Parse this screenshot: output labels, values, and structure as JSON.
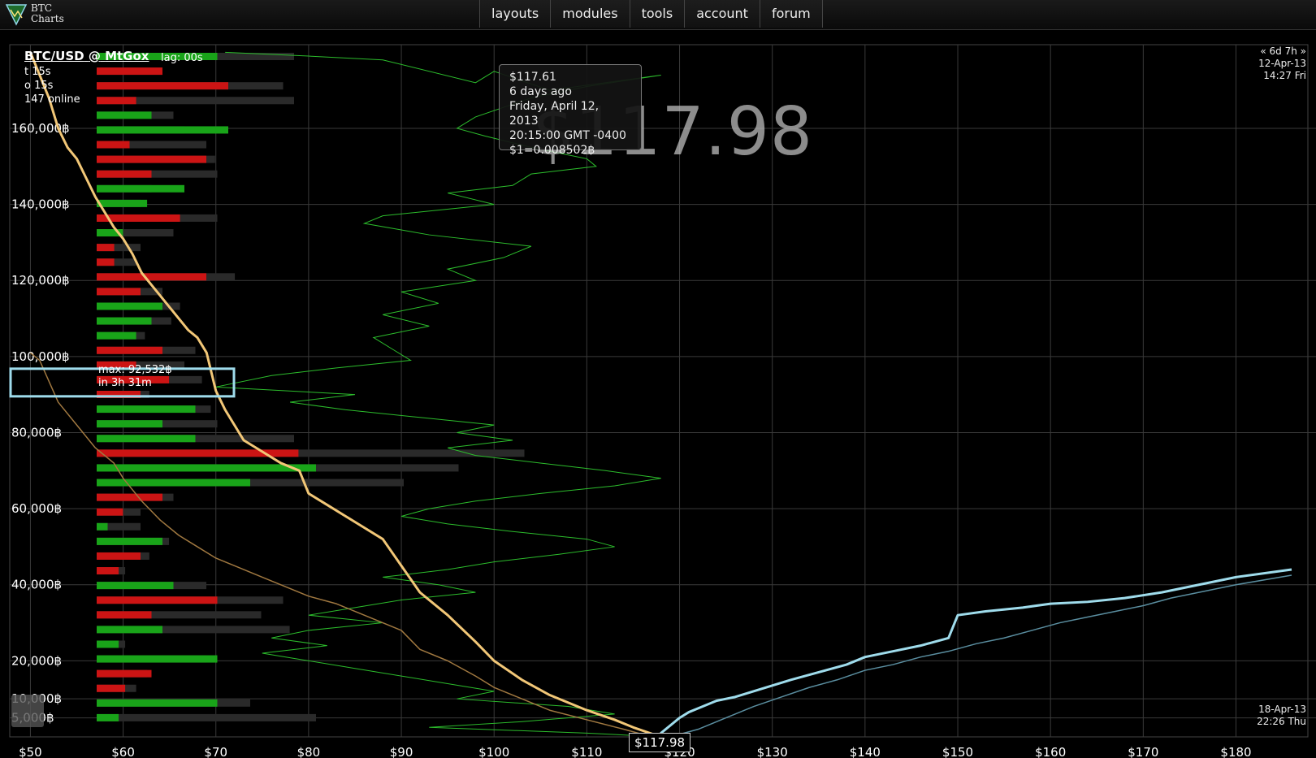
{
  "app": {
    "logo_line1": "BTC",
    "logo_line2": "Charts"
  },
  "nav": [
    "layouts",
    "modules",
    "tools",
    "account",
    "forum"
  ],
  "header": {
    "pair": "BTC/USD",
    "at": "@",
    "exchange": "MtGox",
    "lag": "lag: 00s",
    "lines": [
      "t 15s",
      "o 15s",
      "147 online"
    ]
  },
  "time_top": {
    "nav": "« 6d 7h »",
    "date": "12-Apr-13",
    "time": "14:27 Fri"
  },
  "time_bottom": {
    "date": "18-Apr-13",
    "time": "22:26 Thu"
  },
  "big_price": "$117.98",
  "current_price_label": "$117.98",
  "tooltip": {
    "price": "$117.61",
    "ago": "6 days  ago",
    "date": "Friday, April 12, 2013",
    "time": "20:15:00 GMT -0400",
    "rate": "$1=0.008502฿"
  },
  "max_note": {
    "line1": "max: 92,532฿",
    "line2": "in 3h 31m"
  },
  "colors": {
    "bid_depth": "#f2c777",
    "bid_depth_older": "#a07840",
    "ask_depth": "#9fdcec",
    "ask_depth_older": "#5a8ea0",
    "price": "#2cbc2c",
    "vol_up": "#19a419",
    "vol_down": "#cc1414",
    "grid": "#3a3a3a",
    "highlight": "#9fdcec"
  },
  "chart_data": {
    "type": "line",
    "xlabel": "",
    "ylabel": "",
    "x_ticks": [
      "$50",
      "$60",
      "$70",
      "$80",
      "$90",
      "$100",
      "$110",
      "$120",
      "$130",
      "$140",
      "$150",
      "$160",
      "$170",
      "$180"
    ],
    "xlim": [
      49,
      186
    ],
    "y_ticks": [
      "5,000฿",
      "10,000฿",
      "20,000฿",
      "40,000฿",
      "60,000฿",
      "80,000฿",
      "100,000฿",
      "120,000฿",
      "140,000฿",
      "160,000฿"
    ],
    "y_tick_values": [
      5000,
      10000,
      20000,
      40000,
      60000,
      80000,
      100000,
      120000,
      140000,
      160000
    ],
    "ylim": [
      0,
      182000
    ],
    "series": [
      {
        "kind": "bid_depth",
        "x": [
          50,
          51,
          52,
          53,
          54,
          55,
          56,
          57,
          58,
          59,
          60,
          61,
          62,
          63,
          64,
          65,
          66,
          67,
          68,
          69,
          70,
          71,
          72,
          73,
          75,
          77,
          79,
          80,
          82,
          84,
          86,
          88,
          90,
          92,
          95,
          98,
          100,
          103,
          106,
          110,
          113,
          115,
          117.98
        ],
        "y": [
          180000,
          174000,
          168000,
          160000,
          155000,
          152000,
          147000,
          142000,
          138000,
          134000,
          131000,
          127000,
          122000,
          119000,
          116000,
          113000,
          110000,
          107000,
          105000,
          101000,
          91000,
          86000,
          82000,
          78000,
          75000,
          72000,
          70000,
          64000,
          61000,
          58000,
          55000,
          52000,
          45000,
          38000,
          32000,
          25000,
          20000,
          15000,
          11000,
          7000,
          4500,
          2500,
          0
        ]
      },
      {
        "kind": "bid_depth_older",
        "x": [
          50,
          51,
          53,
          55,
          57,
          59,
          60,
          62,
          64,
          66,
          68,
          70,
          72,
          75,
          78,
          80,
          83,
          86,
          90,
          92,
          95,
          98,
          100,
          103,
          106,
          110,
          114,
          117
        ],
        "y": [
          101000,
          99000,
          88000,
          82000,
          76000,
          72000,
          68000,
          62000,
          57000,
          53000,
          50000,
          47000,
          45000,
          42000,
          39000,
          37000,
          35000,
          32000,
          28000,
          23000,
          20000,
          16000,
          13000,
          10000,
          7000,
          4500,
          2000,
          0
        ]
      },
      {
        "kind": "ask_depth",
        "x": [
          117.98,
          118,
          120,
          121,
          122,
          124,
          126,
          128,
          130,
          132,
          135,
          138,
          140,
          143,
          146,
          149,
          150,
          153,
          157,
          160,
          164,
          168,
          172,
          176,
          180,
          186
        ],
        "y": [
          0,
          1000,
          5000,
          6500,
          7500,
          9500,
          10500,
          12000,
          13500,
          15000,
          17000,
          19000,
          21000,
          22500,
          24000,
          26000,
          32000,
          33000,
          34000,
          35000,
          35500,
          36500,
          38000,
          40000,
          42000,
          44000
        ]
      },
      {
        "kind": "ask_depth_older",
        "x": [
          119,
          122,
          125,
          128,
          131,
          134,
          137,
          140,
          143,
          146,
          149,
          152,
          155,
          158,
          161,
          164,
          167,
          170,
          173,
          176,
          180,
          186
        ],
        "y": [
          0,
          2000,
          5000,
          8000,
          10500,
          13000,
          15000,
          17500,
          19000,
          21000,
          22500,
          24500,
          26000,
          28000,
          30000,
          31500,
          33000,
          34500,
          36500,
          38000,
          40000,
          42500
        ]
      }
    ],
    "price_trace": {
      "kind": "price",
      "x": [
        71,
        80,
        88,
        98,
        100,
        106,
        118,
        110,
        104,
        98,
        96,
        99,
        104,
        110,
        111,
        104,
        102,
        95,
        100,
        88,
        86,
        93,
        104,
        101,
        95,
        98,
        90,
        94,
        88,
        93,
        87,
        89,
        91,
        83,
        76,
        70,
        85,
        78,
        84,
        92,
        100,
        96,
        102,
        95,
        98,
        105,
        112,
        118,
        113,
        105,
        98,
        93,
        90,
        95,
        102,
        110,
        113,
        107,
        100,
        95,
        88,
        94,
        98,
        90,
        85,
        80,
        88,
        80,
        76,
        82,
        75,
        80,
        85,
        90,
        95,
        100,
        96,
        108,
        113,
        103,
        93,
        110,
        118
      ],
      "y": [
        180000,
        179000,
        178000,
        172000,
        175000,
        170000,
        174000,
        171000,
        168000,
        163000,
        160000,
        158000,
        155000,
        152000,
        150000,
        148000,
        145000,
        143000,
        140000,
        137000,
        135000,
        132000,
        129000,
        126000,
        123000,
        120000,
        117000,
        114000,
        111000,
        108000,
        105000,
        102000,
        99000,
        97000,
        95000,
        92000,
        90000,
        88000,
        86000,
        84000,
        82000,
        80000,
        78000,
        76000,
        74000,
        72000,
        70000,
        68000,
        66000,
        64000,
        62000,
        60000,
        58000,
        56000,
        54000,
        52000,
        50000,
        48000,
        46000,
        44000,
        42000,
        40000,
        38000,
        36000,
        34000,
        32000,
        30000,
        28000,
        26000,
        24000,
        22000,
        20000,
        18000,
        16000,
        14000,
        12000,
        10000,
        8000,
        6000,
        4000,
        2500,
        1000,
        0
      ]
    },
    "volume_bars": {
      "note_unit": "relative",
      "up": [
        1,
        0,
        0,
        0,
        1,
        1,
        0,
        0,
        0,
        1,
        1,
        0,
        1,
        0,
        0,
        0,
        0,
        1,
        1,
        1,
        0,
        0,
        0,
        0,
        1,
        1,
        1,
        0,
        1,
        1,
        0,
        0,
        1,
        1,
        0,
        0,
        1,
        0,
        0,
        1,
        1,
        1,
        0,
        0,
        1,
        1
      ],
      "bar": [
        0.55,
        0.3,
        0.6,
        0.18,
        0.25,
        0.6,
        0.15,
        0.5,
        0.25,
        0.4,
        0.23,
        0.38,
        0.12,
        0.08,
        0.08,
        0.5,
        0.2,
        0.3,
        0.25,
        0.18,
        0.3,
        0.18,
        0.33,
        0.2,
        0.45,
        0.3,
        0.45,
        0.92,
        1.0,
        0.7,
        0.3,
        0.12,
        0.05,
        0.3,
        0.2,
        0.1,
        0.35,
        0.55,
        0.25,
        0.3,
        0.1,
        0.55,
        0.25,
        0.13,
        0.55,
        0.1
      ],
      "shadow": [
        0.9,
        0.3,
        0.85,
        0.9,
        0.35,
        0.4,
        0.5,
        0.54,
        0.55,
        0.25,
        0.2,
        0.55,
        0.35,
        0.2,
        0.18,
        0.63,
        0.3,
        0.38,
        0.34,
        0.22,
        0.45,
        0.4,
        0.48,
        0.24,
        0.52,
        0.55,
        0.9,
        1.95,
        1.65,
        1.4,
        0.35,
        0.2,
        0.2,
        0.33,
        0.24,
        0.13,
        0.5,
        0.85,
        0.75,
        0.88,
        0.13,
        0.5,
        0.23,
        0.18,
        0.7,
        1.0
      ]
    }
  }
}
